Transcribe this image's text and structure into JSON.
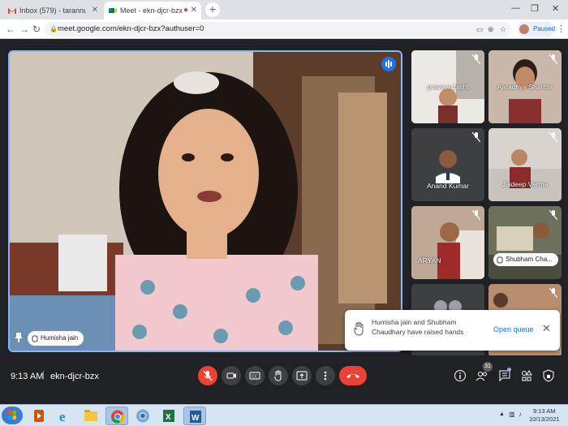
{
  "browser": {
    "tabs": [
      {
        "title": "Inbox (579) - tarannum@theindi",
        "favicon": "gmail-icon"
      },
      {
        "title": "Meet - ekn-djcr-bzx",
        "favicon": "meet-icon"
      }
    ],
    "url": "meet.google.com/ekn-djcr-bzx?authuser=0",
    "profile_label": "Paused"
  },
  "meeting": {
    "presenter_name": "Humisha jain",
    "time": "9:13 AM",
    "separator": "|",
    "code": "ekn-djcr-bzx",
    "participant_count": "31",
    "participants": [
      {
        "name": "praveen bisht",
        "muted": true
      },
      {
        "name": "Aaradhya Sharma",
        "muted": true
      },
      {
        "name": "Anand Kumar",
        "muted": true
      },
      {
        "name": "Jaideep Verma",
        "muted": true
      },
      {
        "name": "ARYAN",
        "muted": true
      },
      {
        "name": "Shubham Cha...",
        "muted": true
      }
    ],
    "notification": {
      "text": "Humisha jain and Shubham Chaudhary have raised hands",
      "action": "Open queue"
    }
  },
  "taskbar": {
    "time": "9:13 AM",
    "date": "10/13/2021"
  },
  "colors": {
    "accent": "#1a73e8",
    "danger": "#ea4335",
    "bg": "#202124"
  }
}
